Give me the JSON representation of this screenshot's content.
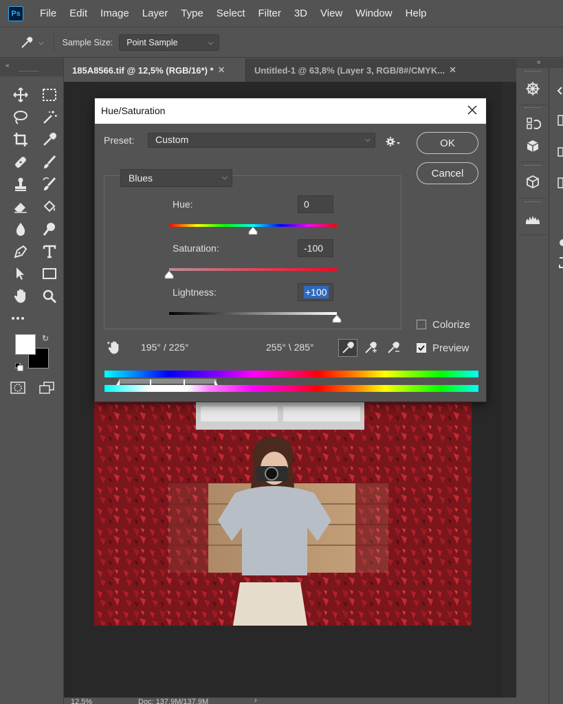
{
  "menubar": {
    "items": [
      "File",
      "Edit",
      "Image",
      "Layer",
      "Type",
      "Select",
      "Filter",
      "3D",
      "View",
      "Window",
      "Help"
    ]
  },
  "options": {
    "sample_size_label": "Sample Size:",
    "sample_size_value": "Point Sample"
  },
  "tabs": [
    {
      "label": "185A8566.tif @ 12,5% (RGB/16*) *",
      "active": true
    },
    {
      "label": "Untitled-1 @ 63,8% (Layer 3, RGB/8#/CMYK...",
      "active": false
    }
  ],
  "status": {
    "zoom": "12,5%",
    "doc": "Doc: 137,9M/137,9M"
  },
  "dialog": {
    "title": "Hue/Saturation",
    "preset_label": "Preset:",
    "preset_value": "Custom",
    "ok_label": "OK",
    "cancel_label": "Cancel",
    "channel_value": "Blues",
    "hue": {
      "label": "Hue:",
      "value": "0",
      "level": 0
    },
    "saturation": {
      "label": "Saturation:",
      "value": "-100",
      "level": -100
    },
    "lightness": {
      "label": "Lightness:",
      "value": "+100",
      "level": 100
    },
    "colorize": {
      "label": "Colorize",
      "checked": false
    },
    "preview": {
      "label": "Preview",
      "checked": true
    },
    "range_left": "195° /  225°",
    "range_right": "255° \\  285°",
    "icons": [
      "hand-icon",
      "eyedropper-icon",
      "eyedropper-plus-icon",
      "eyedropper-minus-icon",
      "gear-icon",
      "close-icon"
    ]
  },
  "colors": {
    "panel": "#535353",
    "dark": "#282828",
    "accent": "#2f6ac0",
    "ps_blue": "#31a8ff"
  }
}
